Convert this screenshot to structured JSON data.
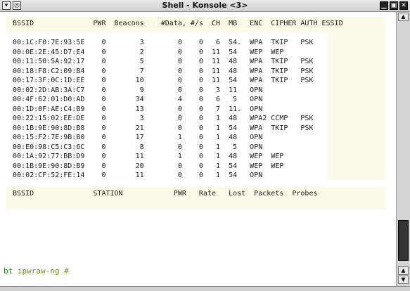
{
  "window": {
    "title": "Shell - Konsole <3>",
    "buttons": [
      "minimize",
      "maximize",
      "close"
    ]
  },
  "ap_table": {
    "header": " BSSID              PWR  Beacons    #Data, #/s  CH  MB   ENC  CIPHER AUTH ESSID",
    "rows": [
      " 00:1C:F0:7E:93:5E    0        3        0    0   6  54.  WPA  TKIP   PSK",
      " 00:0E:2E:45:D7:E4    0        2        0    0  11  54   WEP  WEP",
      " 00:11:50:5A:92:17    0        5        0    0  11  48   WPA  TKIP   PSK",
      " 00:18:F8:C2:09:B4    0        7        0    0  11  48   WPA  TKIP   PSK",
      " 00:17:3F:0C:1D:EE    0       10        0    0  11  54   WPA  TKIP   PSK",
      " 00:02:2D:AB:3A:C7    0        9        0    0   3  11   OPN",
      " 00:4F:62:01:D0:AD    0       34        4    0   6   5   OPN",
      " 00:1D:0F:AE:C4:B9    0       13        0    0   7  11.  OPN",
      " 00:22:15:02:EE:DE    0        3        0    0   1  48   WPA2 CCMP   PSK",
      " 00:1B:9E:90:8D:B8    0       21        0    0   1  54   WPA  TKIP   PSK",
      " 00:15:F2:7E:9B:B0    0       17        1    0   1  48   OPN",
      " 00:E0:98:C5:C3:6C    0        8        0    0   1   5   OPN",
      " 00:1A:92:77:BB:D9    0       11        1    0   1  48   WEP  WEP",
      " 00:1B:9E:90:8D:B9    0       20        0    0   1  54   WEP  WEP",
      " 00:02:CF:52:FE:14    0       11        0    0   1  54   OPN"
    ]
  },
  "station_table": {
    "header": " BSSID              STATION            PWR   Rate   Lost  Packets  Probes"
  },
  "prompt": {
    "host": "bt",
    "path": "ipwraw-ng #"
  },
  "colors": {
    "highlight": "#fbfbe8",
    "prompt_host": "#2a8a2a",
    "prompt_path": "#7a8a20"
  }
}
